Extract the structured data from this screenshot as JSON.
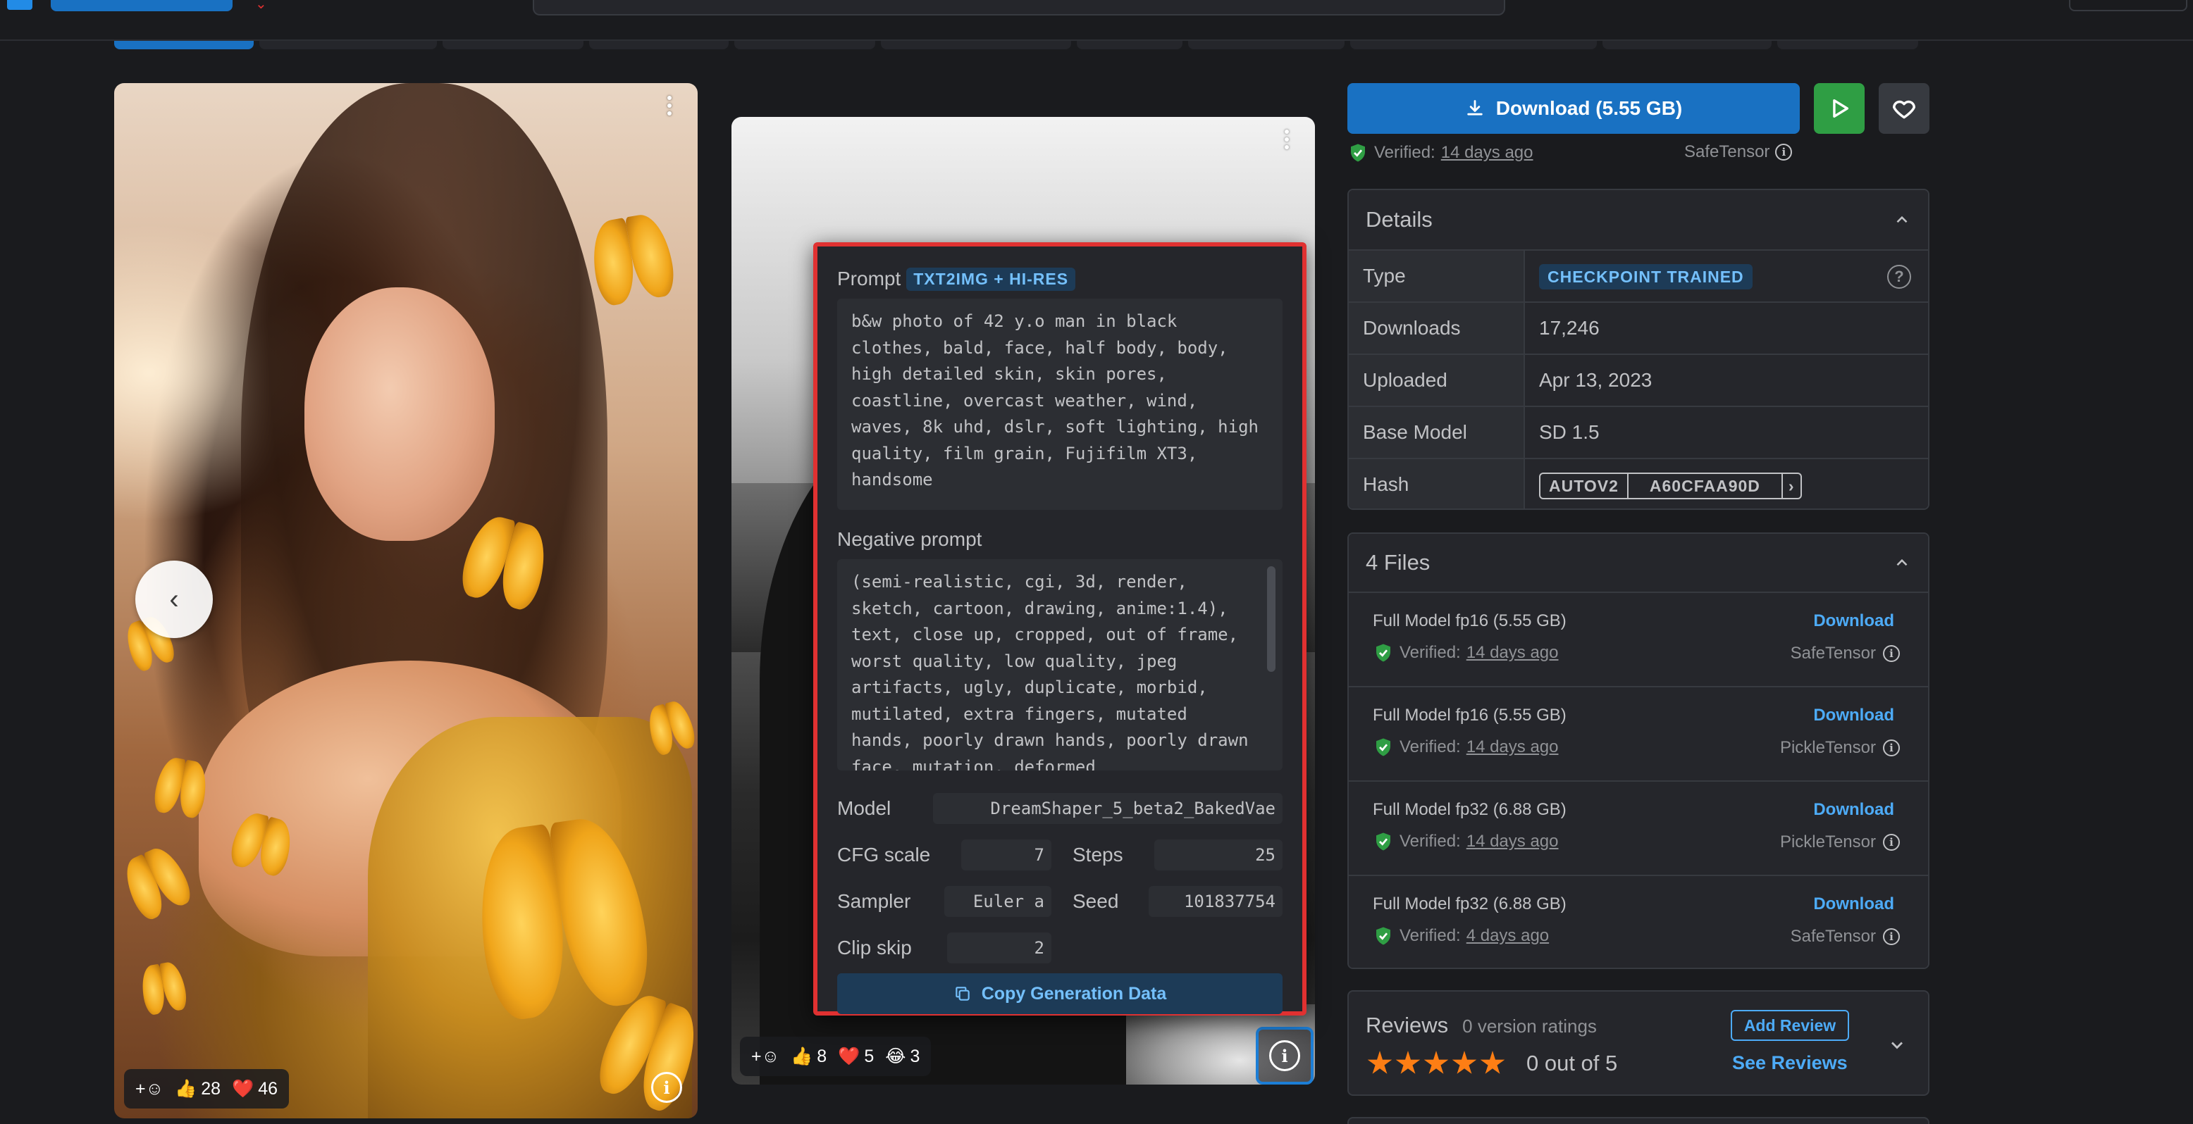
{
  "popover": {
    "prompt_label": "Prompt",
    "prompt_badge": "TXT2IMG + HI-RES",
    "prompt_text": "b&w photo of 42 y.o man in black clothes, bald, face, half body, body, high detailed skin, skin pores, coastline, overcast weather, wind, waves, 8k uhd, dslr, soft lighting, high quality, film grain, Fujifilm XT3, handsome",
    "negative_label": "Negative prompt",
    "negative_text": "(semi-realistic, cgi, 3d, render, sketch, cartoon, drawing, anime:1.4), text, close up, cropped, out of frame, worst quality, low quality, jpeg artifacts, ugly, duplicate, morbid, mutilated, extra fingers, mutated hands, poorly drawn hands, poorly drawn face, mutation, deformed",
    "model_label": "Model",
    "model_value": "DreamShaper_5_beta2_BakedVae",
    "cfg_label": "CFG scale",
    "cfg_value": "7",
    "steps_label": "Steps",
    "steps_value": "25",
    "sampler_label": "Sampler",
    "sampler_value": "Euler a",
    "seed_label": "Seed",
    "seed_value": "101837754",
    "clip_label": "Clip skip",
    "clip_value": "2",
    "copy_label": "Copy Generation Data"
  },
  "cards": [
    {
      "likes": "28",
      "hearts": "46"
    },
    {
      "likes": "8",
      "hearts": "5",
      "laughs": "3"
    }
  ],
  "sidebar": {
    "download_label": "Download (5.55 GB)",
    "verified_label": "Verified:",
    "verified_when": "14 days ago",
    "format": "SafeTensor",
    "details_title": "Details",
    "details": [
      {
        "key": "Type",
        "value": "CHECKPOINT TRAINED"
      },
      {
        "key": "Downloads",
        "value": "17,246"
      },
      {
        "key": "Uploaded",
        "value": "Apr 13, 2023"
      },
      {
        "key": "Base Model",
        "value": "SD 1.5"
      },
      {
        "key": "Hash",
        "value": ""
      }
    ],
    "hash_type": "AUTOV2",
    "hash_value": "A60CFAA90D",
    "files_title": "4 Files",
    "files": [
      {
        "name": "Full Model fp16 (5.55 GB)",
        "download": "Download",
        "verified": "Verified:",
        "when": "14 days ago",
        "format": "SafeTensor"
      },
      {
        "name": "Full Model fp16 (5.55 GB)",
        "download": "Download",
        "verified": "Verified:",
        "when": "14 days ago",
        "format": "PickleTensor"
      },
      {
        "name": "Full Model fp32 (6.88 GB)",
        "download": "Download",
        "verified": "Verified:",
        "when": "14 days ago",
        "format": "PickleTensor"
      },
      {
        "name": "Full Model fp32 (6.88 GB)",
        "download": "Download",
        "verified": "Verified:",
        "when": "4 days ago",
        "format": "SafeTensor"
      }
    ],
    "reviews_title": "Reviews",
    "reviews_count": "0 version ratings",
    "rating_text": "0 out of 5",
    "add_review": "Add Review",
    "see_reviews": "See Reviews"
  },
  "colors": {
    "accent": "#1971c2",
    "link": "#4dabf7",
    "play": "#2f9e44",
    "highlight_border": "#e03131",
    "star": "#fd7e14"
  }
}
